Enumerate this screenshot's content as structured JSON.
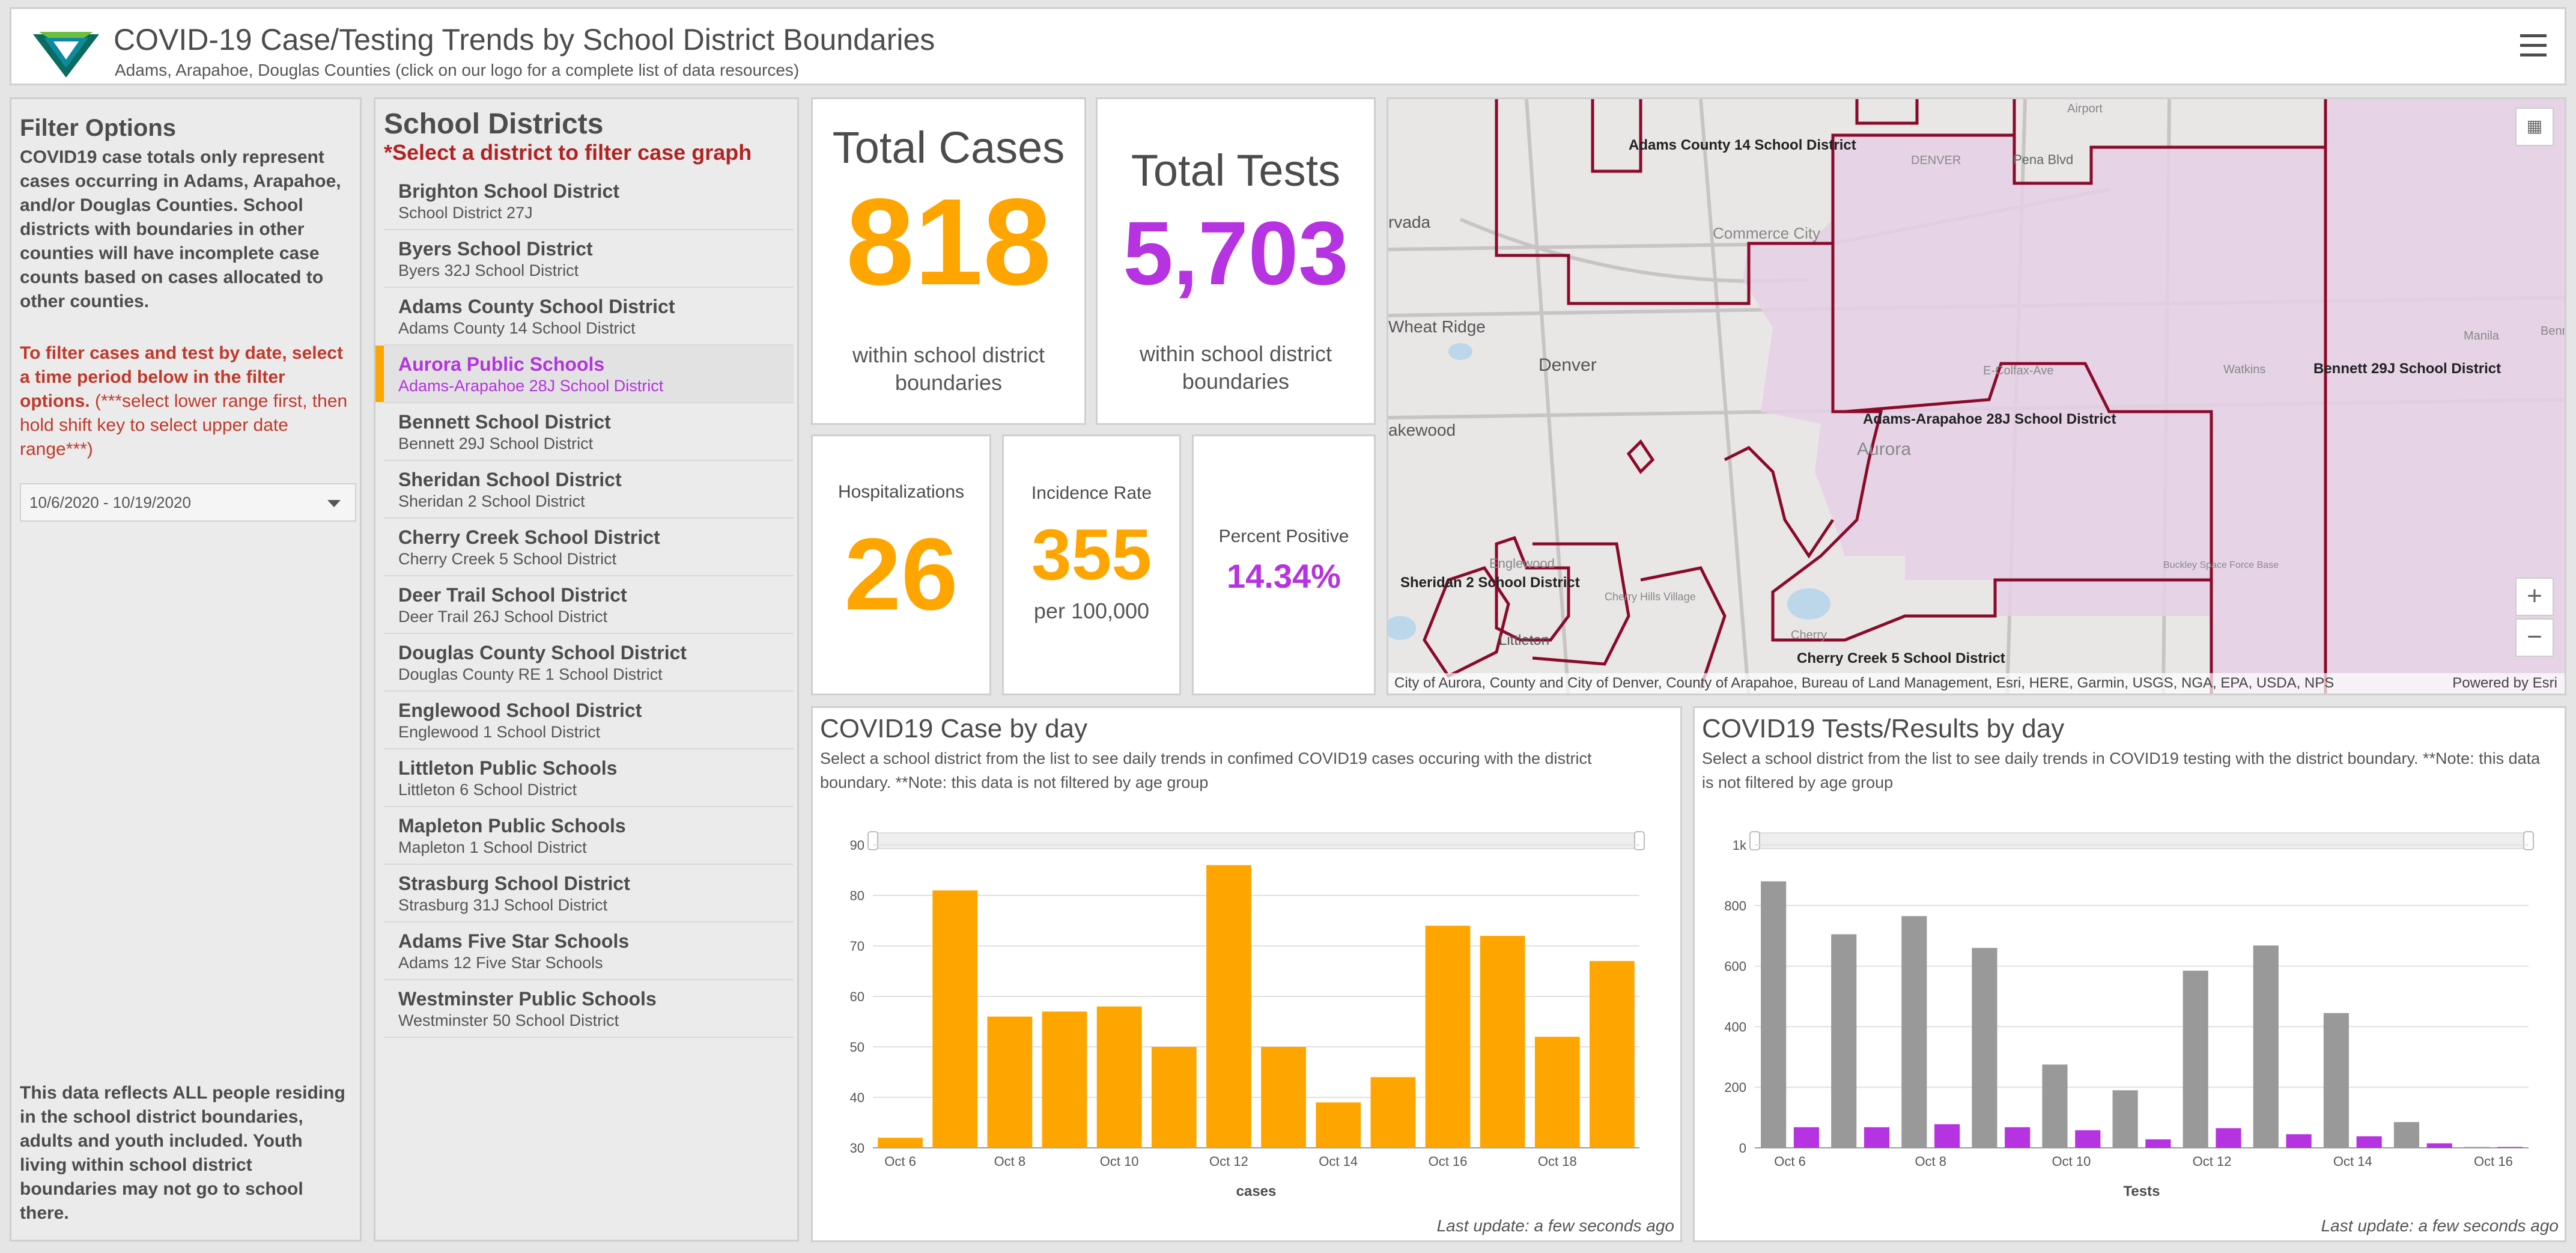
{
  "header": {
    "title": "COVID-19 Case/Testing Trends by School District Boundaries",
    "subtitle": "Adams, Arapahoe, Douglas Counties (click on our logo for a complete list of data resources)",
    "logo_icon": "tri-county-health-logo-icon",
    "menu_icon": "hamburger-menu-icon"
  },
  "filter": {
    "title": "Filter Options",
    "description": "COVID19 case totals only represent cases occurring in Adams, Arapahoe, and/or Douglas Counties. School districts with boundaries in other counties will have incomplete case counts based on cases allocated to other counties.",
    "instruction_bold": "To filter cases and test by date, select a time period below in the filter options.",
    "instruction_note": " (***select lower range first, then hold shift key to select upper date range***)",
    "date_range": "10/6/2020 - 10/19/2020",
    "footer": "This data reflects ALL people residing in the school district boundaries, adults and youth included. Youth living within school district boundaries may not go to school there."
  },
  "districts": {
    "title": "School Districts",
    "hint": "*Select a district to filter case graph",
    "items": [
      {
        "name": "Brighton School District",
        "sub": "School District 27J"
      },
      {
        "name": "Byers School District",
        "sub": "Byers 32J School District"
      },
      {
        "name": "Adams County School District",
        "sub": "Adams County 14 School District"
      },
      {
        "name": "Aurora Public Schools",
        "sub": "Adams-Arapahoe 28J School District"
      },
      {
        "name": "Bennett School District",
        "sub": "Bennett 29J School District"
      },
      {
        "name": "Sheridan School District",
        "sub": "Sheridan 2 School District"
      },
      {
        "name": "Cherry Creek School District",
        "sub": "Cherry Creek 5 School District"
      },
      {
        "name": "Deer Trail School District",
        "sub": "Deer Trail 26J School District"
      },
      {
        "name": "Douglas County School District",
        "sub": "Douglas County RE 1 School District"
      },
      {
        "name": "Englewood School District",
        "sub": "Englewood 1 School District"
      },
      {
        "name": "Littleton Public Schools",
        "sub": "Littleton 6 School District"
      },
      {
        "name": "Mapleton Public Schools",
        "sub": "Mapleton 1 School District"
      },
      {
        "name": "Strasburg School District",
        "sub": "Strasburg 31J School District"
      },
      {
        "name": "Adams Five Star Schools",
        "sub": "Adams 12 Five Star Schools"
      },
      {
        "name": "Westminster Public Schools",
        "sub": "Westminster 50 School District"
      }
    ],
    "selected_index": 3
  },
  "indicators": {
    "cases": {
      "title": "Total Cases",
      "value": "818",
      "foot": "within school district boundaries",
      "color": "#ffa500"
    },
    "tests": {
      "title": "Total Tests",
      "value": "5,703",
      "foot": "within school district boundaries",
      "color": "#b533e0"
    },
    "hospitalizations": {
      "title": "Hospitalizations",
      "value": "26",
      "color": "#ffa500"
    },
    "incidence": {
      "title": "Incidence Rate",
      "value": "355",
      "unit": "per 100,000",
      "color": "#ffa500"
    },
    "positive": {
      "title": "Percent Positive",
      "value": "14.34%",
      "color": "#b533e0"
    }
  },
  "map": {
    "labels": {
      "adams14": "Adams County 14 School District",
      "aurora28j": "Adams-Arapahoe 28J School District",
      "bennett29j": "Bennett 29J School District",
      "sheridan2": "Sheridan 2 School District",
      "cherrycreek5": "Cherry Creek 5 School District",
      "denver": "Denver",
      "aurora": "Aurora",
      "lakewood": "akewood",
      "wheatridge": "Wheat Ridge",
      "arvada": "rvada",
      "commercecity": "Commerce City",
      "pena": "Pena Blvd",
      "littleton": "Littleton",
      "englewood": "Englewood",
      "colfax": "E-Colfax-Ave",
      "airport": "Airport",
      "denver_small": "DENVER",
      "watkins": "Watkins",
      "manila": "Manila",
      "bennett": "Benn",
      "cherryhills": "Cherry Hills Village",
      "cherry": "Cherry",
      "buckley": "Buckley Space Force Base"
    },
    "attribution": "City of Aurora, County and City of Denver, County of Arapahoe, Bureau of Land Management, Esri, HERE, Garmin, USGS, NGA, EPA, USDA, NPS",
    "powered": "Powered by Esri",
    "zoom_in": "+",
    "zoom_out": "−",
    "boundary_color": "#8b0a2a",
    "fill_color": "#e5d0e5"
  },
  "charts": {
    "cases": {
      "title": "COVID19 Case by day",
      "desc": "Select a school district from the list to see daily trends in confimed COVID19 cases occuring with the district boundary. **Note: this data is not filtered by age group",
      "update": "Last update: a few seconds ago"
    },
    "tests": {
      "title": "COVID19 Tests/Results by day",
      "desc": "Select a school district from the list to see daily trends in COVID19 testing with the district boundary. **Note: this data is not filtered by age group",
      "update": "Last update: a few seconds ago"
    }
  },
  "chart_data": [
    {
      "type": "bar",
      "categories": [
        "Oct 6",
        "Oct 7",
        "Oct 8",
        "Oct 9",
        "Oct 10",
        "Oct 11",
        "Oct 12",
        "Oct 13",
        "Oct 14",
        "Oct 15",
        "Oct 16",
        "Oct 17",
        "Oct 18",
        "Oct 19"
      ],
      "tick_labels": [
        "Oct 6",
        "Oct 8",
        "Oct 10",
        "Oct 12",
        "Oct 14",
        "Oct 16",
        "Oct 18"
      ],
      "values": [
        32,
        81,
        56,
        57,
        58,
        50,
        86,
        50,
        39,
        44,
        74,
        72,
        52,
        67
      ],
      "xlabel": "cases",
      "ylabel": "",
      "ylim": [
        30,
        90
      ],
      "yticks": [
        30,
        40,
        50,
        60,
        70,
        80,
        90
      ],
      "colors": [
        "#ffa500"
      ],
      "grid": true
    },
    {
      "type": "bar",
      "categories": [
        "Oct 6",
        "Oct 7",
        "Oct 8",
        "Oct 9",
        "Oct 10",
        "Oct 11",
        "Oct 12",
        "Oct 13",
        "Oct 14",
        "Oct 15",
        "Oct 16"
      ],
      "tick_labels": [
        "Oct 6",
        "Oct 8",
        "Oct 10",
        "Oct 12",
        "Oct 14",
        "Oct 16"
      ],
      "series": [
        {
          "values": [
            880,
            705,
            765,
            660,
            275,
            190,
            585,
            668,
            445,
            85,
            3
          ]
        },
        {
          "values": [
            68,
            68,
            78,
            68,
            58,
            28,
            65,
            45,
            38,
            15,
            3
          ]
        }
      ],
      "xlabel": "Tests",
      "ylabel": "",
      "ylim": [
        0,
        1000
      ],
      "yticks": [
        0,
        200,
        400,
        600,
        800,
        1000
      ],
      "ytick_labels": [
        "0",
        "200",
        "400",
        "600",
        "800",
        "1k"
      ],
      "colors": [
        "#999999",
        "#b533e0"
      ],
      "grid": true
    }
  ]
}
